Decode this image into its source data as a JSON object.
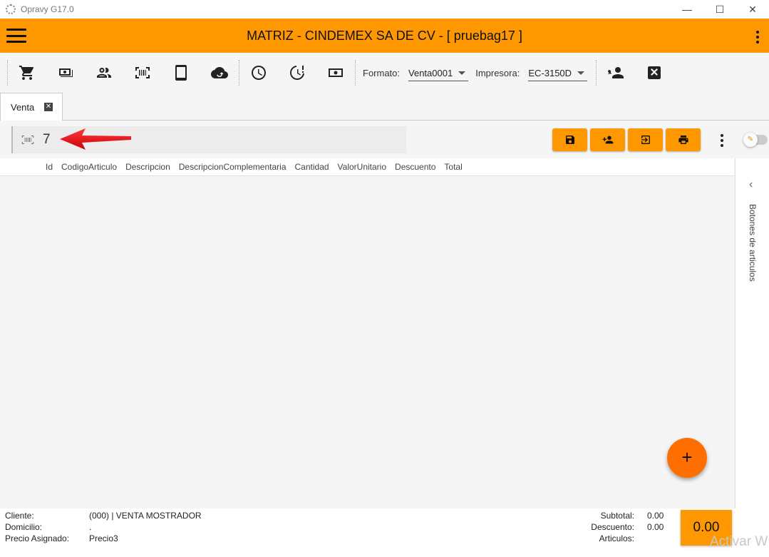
{
  "window": {
    "title": "Opravy G17.0",
    "minimize": "—",
    "maximize": "☐",
    "close": "✕"
  },
  "appbar": {
    "title": "MATRIZ - CINDEMEX SA DE CV - [ pruebag17 ]"
  },
  "toolbar": {
    "formato_label": "Formato:",
    "formato_value": "Venta0001",
    "impresora_label": "Impresora:",
    "impresora_value": "EC-3150D"
  },
  "tabs": [
    {
      "label": "Venta",
      "close": "✕"
    }
  ],
  "scan": {
    "value": "7"
  },
  "grid": {
    "columns": [
      "Id",
      "CodigoArticulo",
      "Descripcion",
      "DescripcionComplementaria",
      "Cantidad",
      "ValorUnitario",
      "Descuento",
      "Total"
    ]
  },
  "side_panel": {
    "label": "Botones de articulos",
    "chevron": "‹"
  },
  "fab": {
    "label": "+"
  },
  "footer": {
    "cliente_label": "Cliente:",
    "cliente_value": "(000) | VENTA MOSTRADOR",
    "domicilio_label": "Domicilio:",
    "domicilio_value": ".",
    "precio_label": "Precio Asignado:",
    "precio_value": "Precio3",
    "subtotal_label": "Subtotal:",
    "subtotal_value": "0.00",
    "descuento_label": "Descuento:",
    "descuento_value": "0.00",
    "articulos_label": "Articulos:",
    "total_value": "0.00",
    "watermark": "Activar W"
  },
  "colors": {
    "accent": "#ff9800",
    "fab": "#ff6f00",
    "arrow": "#e8141b"
  }
}
